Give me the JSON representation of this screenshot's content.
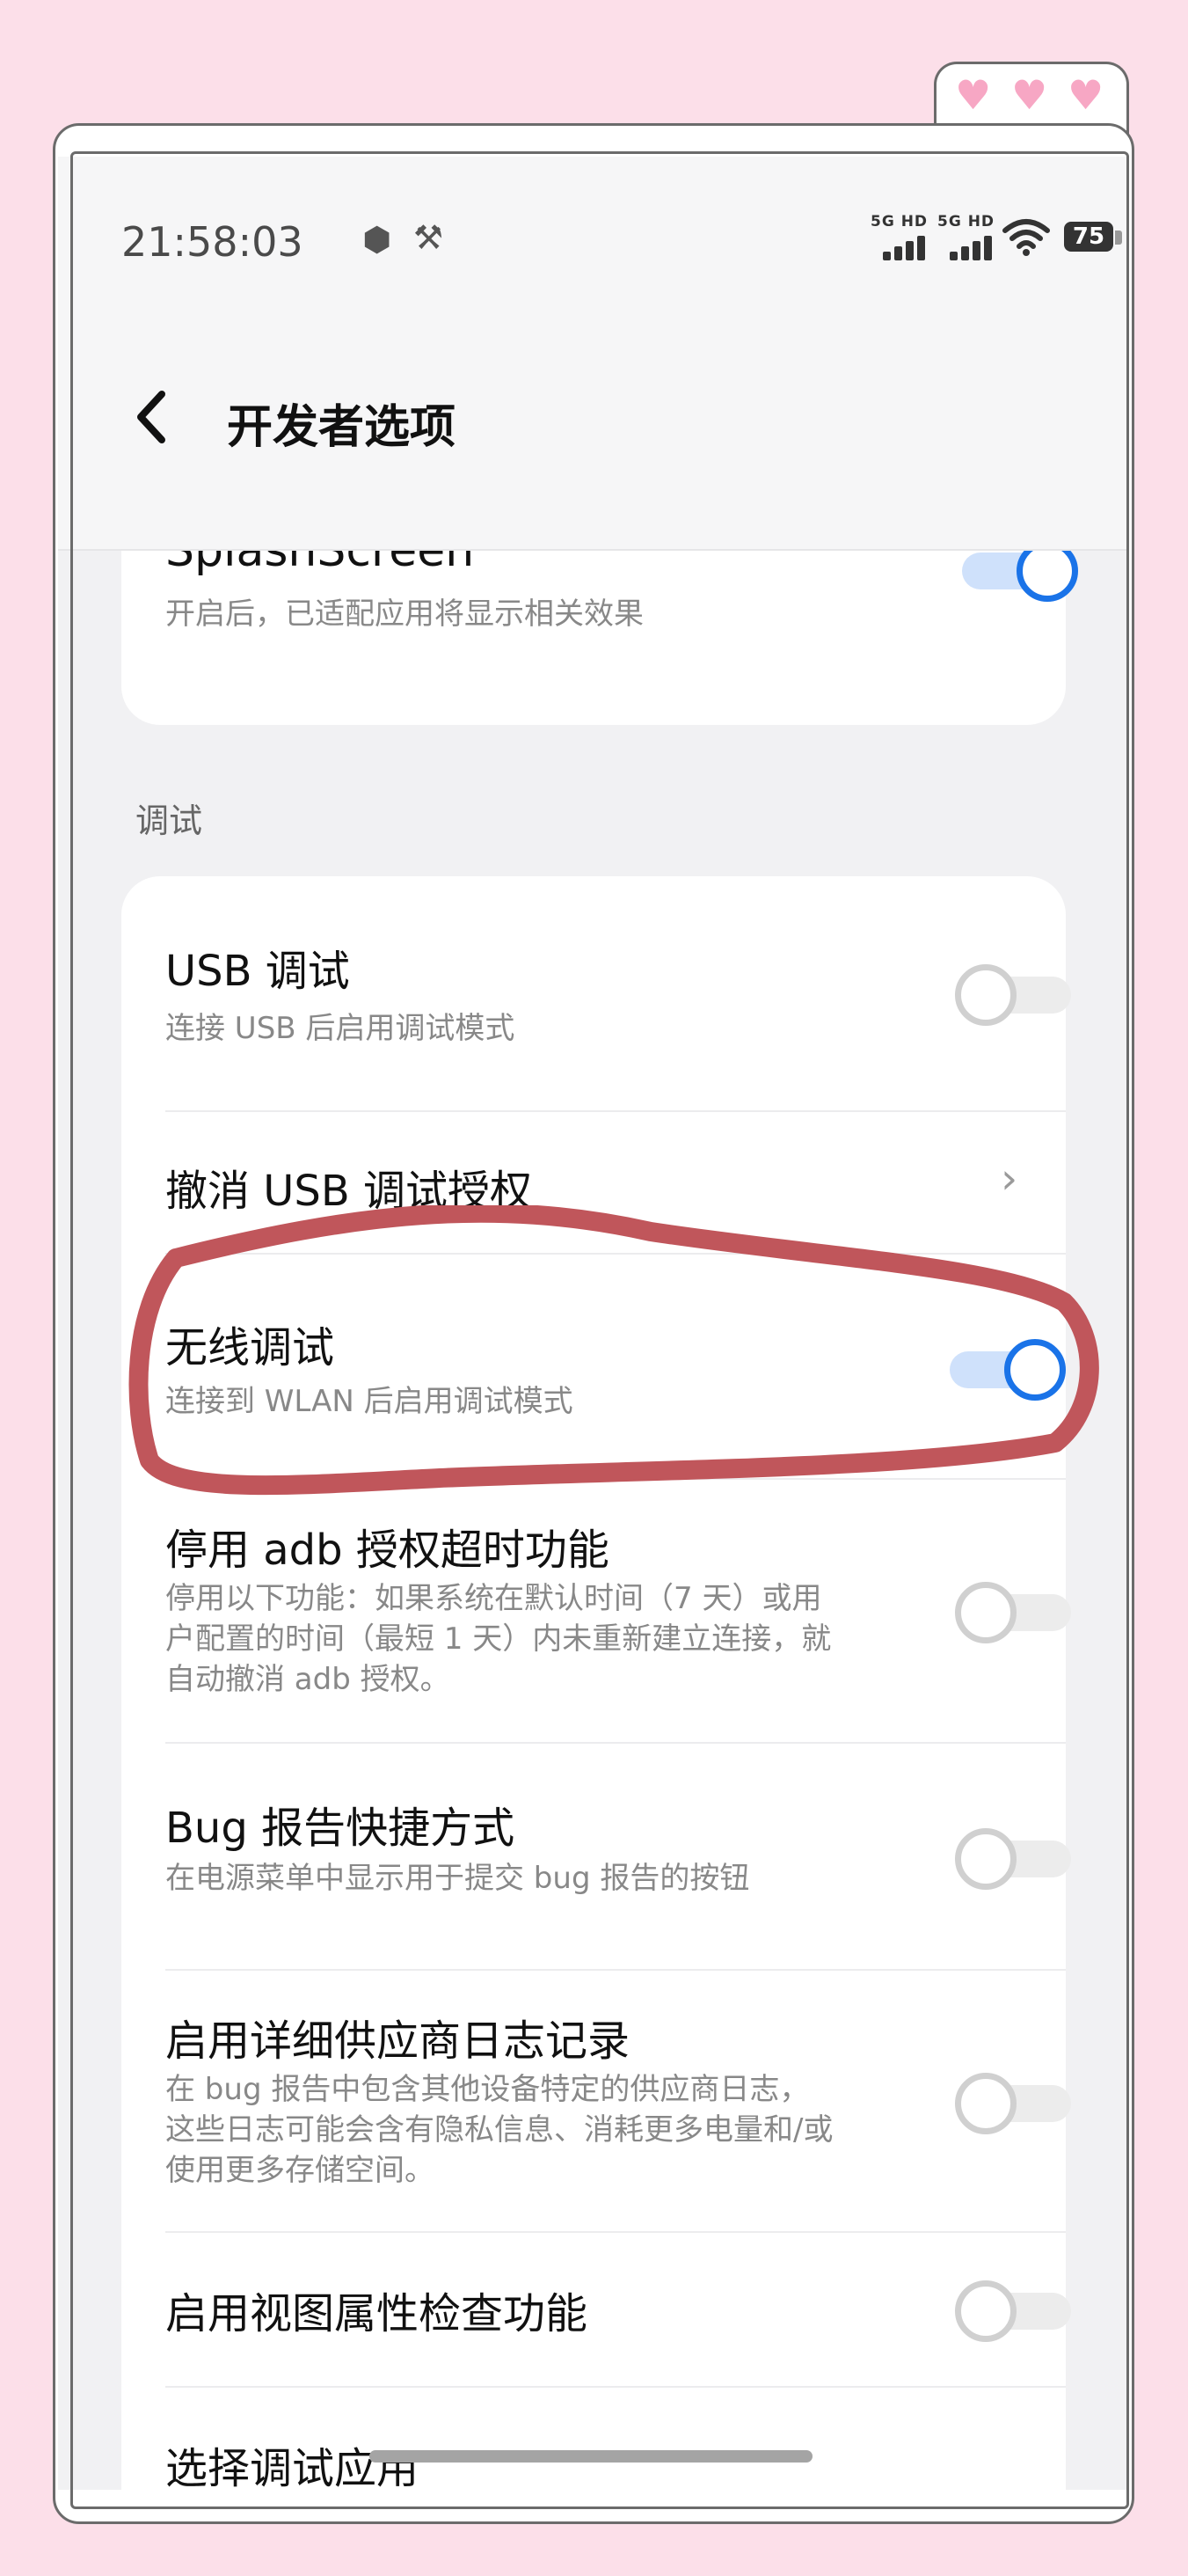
{
  "status_bar": {
    "time": "21:58:03",
    "network_1": "5G HD",
    "network_2": "5G HD",
    "battery": "75"
  },
  "header": {
    "title": "开发者选项"
  },
  "splash_card": {
    "title": "SplashScreen",
    "desc": "开启后，已适配应用将显示相关效果",
    "toggle_on": true
  },
  "section": {
    "label": "调试"
  },
  "debug_items": [
    {
      "title": "USB 调试",
      "desc": "连接 USB 后启用调试模式",
      "toggle_on": false
    },
    {
      "title": "撤消 USB 调试授权"
    },
    {
      "title": "无线调试",
      "desc": "连接到 WLAN 后启用调试模式",
      "toggle_on": true
    },
    {
      "title": "停用 adb 授权超时功能",
      "desc": "停用以下功能：如果系统在默认时间（7 天）或用户配置的时间（最短 1 天）内未重新建立连接，就自动撤消 adb 授权。",
      "toggle_on": false
    },
    {
      "title": "Bug 报告快捷方式",
      "desc": "在电源菜单中显示用于提交 bug 报告的按钮",
      "toggle_on": false
    },
    {
      "title": "启用详细供应商日志记录",
      "desc": "在 bug 报告中包含其他设备特定的供应商日志，这些日志可能会含有隐私信息、消耗更多电量和/或使用更多存储空间。",
      "toggle_on": false
    },
    {
      "title": "启用视图属性检查功能",
      "toggle_on": false
    },
    {
      "title": "选择调试应用"
    }
  ],
  "colors": {
    "accent": "#1a73e8",
    "highlight_stroke": "#c0565b",
    "page_background": "#fcdfe9"
  }
}
